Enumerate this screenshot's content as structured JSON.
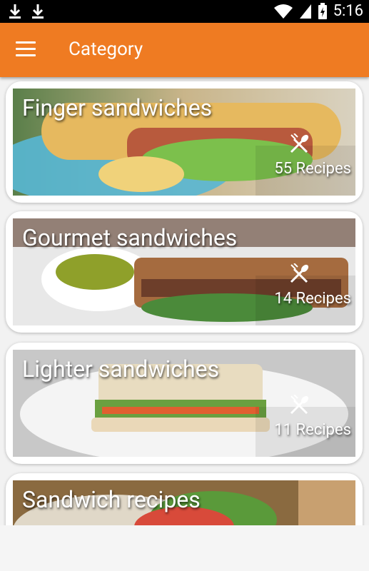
{
  "status_bar": {
    "time": "5:16",
    "left_icons": [
      "download-icon",
      "download-icon"
    ],
    "right_icons": [
      "wifi-icon",
      "signal-icon",
      "battery-charging-icon"
    ]
  },
  "app_bar": {
    "title": "Category",
    "menu_icon": "menu-icon",
    "color": "#ef7b22"
  },
  "categories": [
    {
      "title": "Finger sandwiches",
      "count": "55 Recipes",
      "icon": "fork-knife-icon"
    },
    {
      "title": "Gourmet sandwiches",
      "count": "14 Recipes",
      "icon": "fork-knife-icon"
    },
    {
      "title": "Lighter sandwiches",
      "count": "11 Recipes",
      "icon": "fork-knife-icon"
    },
    {
      "title": "Sandwich recipes",
      "count": "",
      "icon": "fork-knife-icon"
    }
  ]
}
